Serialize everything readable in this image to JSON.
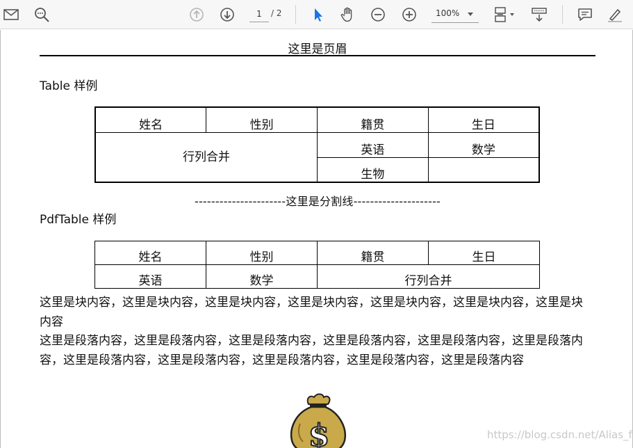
{
  "toolbar": {
    "page_current": "1",
    "page_total": "/ 2",
    "zoom": "100%"
  },
  "document": {
    "header": "这里是页眉",
    "table_title": "Table 样例",
    "table1": {
      "row1": [
        "姓名",
        "性别",
        "籍贯",
        "生日"
      ],
      "merged_cell": "行列合并",
      "row2": [
        "英语",
        "数学"
      ],
      "row3": [
        "生物",
        ""
      ]
    },
    "divider": "----------------------这里是分割线---------------------",
    "pdftable_title": "PdfTable 样例",
    "table2": {
      "row1": [
        "姓名",
        "性别",
        "籍贯",
        "生日"
      ],
      "row2": [
        "英语",
        "数学"
      ],
      "merged_cell": "行列合并"
    },
    "block_text": "这里是块内容，这里是块内容，这里是块内容，这里是块内容，这里是块内容，这里是块内容，这里是块内容",
    "paragraph_text": "这里是段落内容，这里是段落内容，这里是段落内容，这里是段落内容，这里是段落内容，这里是段落内容，这里是段落内容，这里是段落内容，这里是段落内容，这里是段落内容，这里是段落内容"
  },
  "watermark": "https://blog.csdn.net/Alias_fa",
  "colors": {
    "select_tool": "#1a73e8",
    "icon": "#555555"
  }
}
